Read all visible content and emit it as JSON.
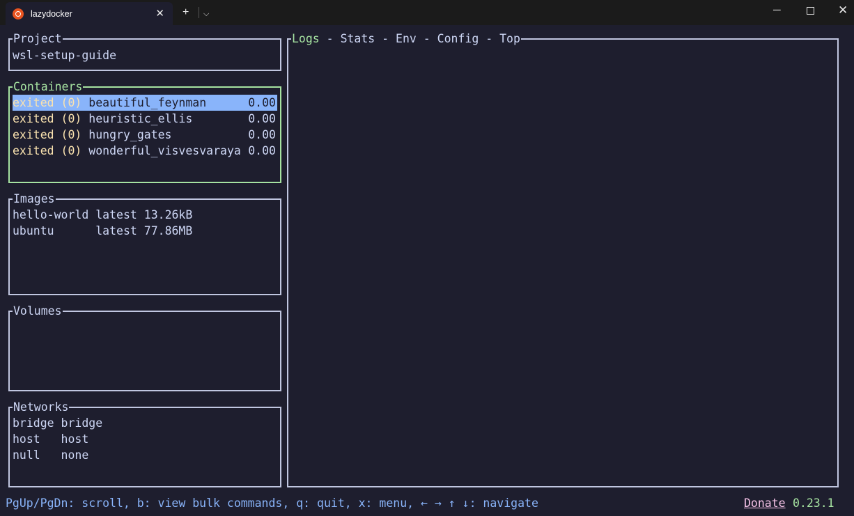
{
  "window": {
    "tab_title": "lazydocker",
    "new_tab_glyph": "+",
    "dropdown_glyph": "⌵",
    "close_glyph": "✕",
    "minimize_glyph": "─",
    "window_close_glyph": "✕"
  },
  "project": {
    "title": "Project",
    "name": "wsl-setup-guide"
  },
  "containers": {
    "title": "Containers",
    "items": [
      {
        "status": "exited (0)",
        "name": "beautiful_feynman",
        "cpu": "0.00"
      },
      {
        "status": "exited (0)",
        "name": "heuristic_ellis",
        "cpu": "0.00"
      },
      {
        "status": "exited (0)",
        "name": "hungry_gates",
        "cpu": "0.00"
      },
      {
        "status": "exited (0)",
        "name": "wonderful_visvesvaraya",
        "cpu": "0.00"
      }
    ]
  },
  "images": {
    "title": "Images",
    "items": [
      {
        "name": "hello-world",
        "tag": "latest",
        "size": "13.26kB"
      },
      {
        "name": "ubuntu     ",
        "tag": "latest",
        "size": "77.86MB"
      }
    ]
  },
  "volumes": {
    "title": "Volumes"
  },
  "networks": {
    "title": "Networks",
    "items": [
      {
        "name": "bridge",
        "driver": "bridge"
      },
      {
        "name": "host  ",
        "driver": "host"
      },
      {
        "name": "null  ",
        "driver": "none"
      }
    ]
  },
  "main": {
    "tabs": [
      "Logs",
      "Stats",
      "Env",
      "Config",
      "Top"
    ],
    "separator": " - "
  },
  "footer": {
    "keybindings": "PgUp/PgDn: scroll, b: view bulk commands, q: quit, x: menu, ← → ↑ ↓: navigate",
    "donate": "Donate",
    "version": "0.23.1"
  },
  "colors": {
    "background": "#1e1e2e",
    "border": "#c0c6e0",
    "active_border": "#a6e3a1",
    "status_exited": "#f9e2af",
    "selection": "#89b4fa",
    "footer_text": "#89b4fa",
    "donate": "#f5c2e7"
  }
}
